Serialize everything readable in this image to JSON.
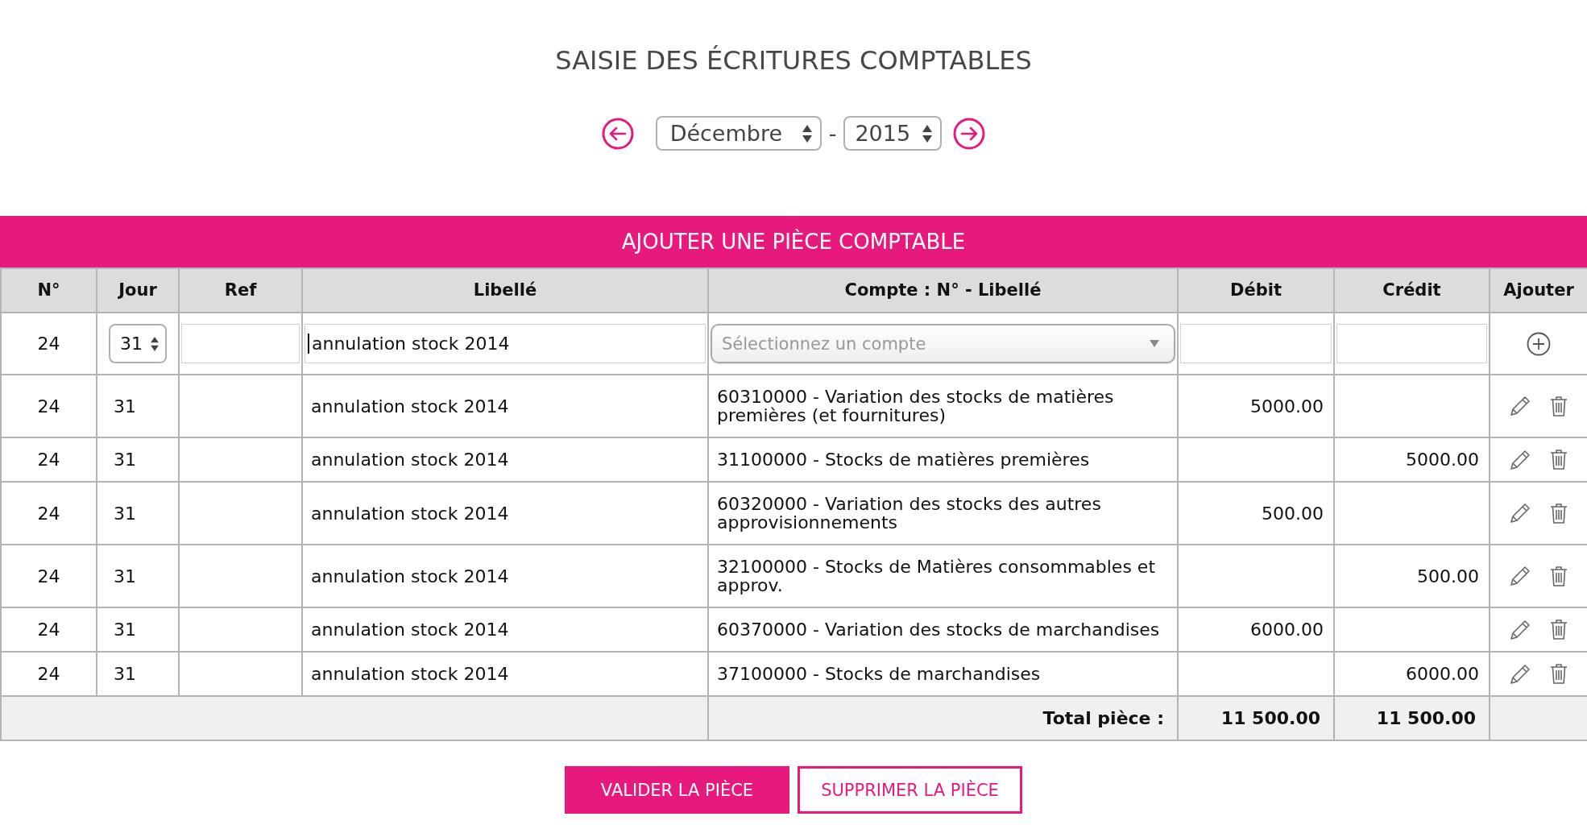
{
  "title": "SAISIE DES ÉCRITURES COMPTABLES",
  "period": {
    "month": "Décembre",
    "separator": "-",
    "year": "2015"
  },
  "section_title": "AJOUTER UNE PIÈCE COMPTABLE",
  "table": {
    "columns": [
      "N°",
      "Jour",
      "Ref",
      "Libellé",
      "Compte : N° - Libellé",
      "Débit",
      "Crédit",
      "Ajouter"
    ],
    "entry_row": {
      "number": "24",
      "day": "31",
      "label": {
        "value": "annulation stock 2014",
        "focused": true
      },
      "account": {
        "placeholder": "Sélectionnez un compte"
      }
    },
    "rows": [
      {
        "number": "24",
        "day": "31",
        "label": "annulation stock 2014",
        "account": "60310000 - Variation des stocks de matières premières (et fournitures)",
        "debit": "5000.00"
      },
      {
        "number": "24",
        "day": "31",
        "label": "annulation stock 2014",
        "account": "31100000 - Stocks de matières premières",
        "credit": "5000.00"
      },
      {
        "number": "24",
        "day": "31",
        "label": "annulation stock 2014",
        "account": "60320000 - Variation des stocks des autres approvisionnements",
        "debit": "500.00"
      },
      {
        "number": "24",
        "day": "31",
        "label": "annulation stock 2014",
        "account": "32100000 - Stocks de Matières consommables et approv.",
        "credit": "500.00"
      },
      {
        "number": "24",
        "day": "31",
        "label": "annulation stock 2014",
        "account": "60370000 - Variation des stocks de marchandises",
        "debit": "6000.00"
      },
      {
        "number": "24",
        "day": "31",
        "label": "annulation stock 2014",
        "account": "37100000 - Stocks de marchandises",
        "credit": "6000.00"
      }
    ],
    "total": {
      "label": "Total pièce :",
      "debit": "11 500.00",
      "credit": "11 500.00"
    }
  },
  "buttons": [
    {
      "label": "VALIDER LA PIÈCE",
      "kind": "primary"
    },
    {
      "label": "SUPPRIMER LA PIÈCE",
      "kind": "outline"
    }
  ]
}
